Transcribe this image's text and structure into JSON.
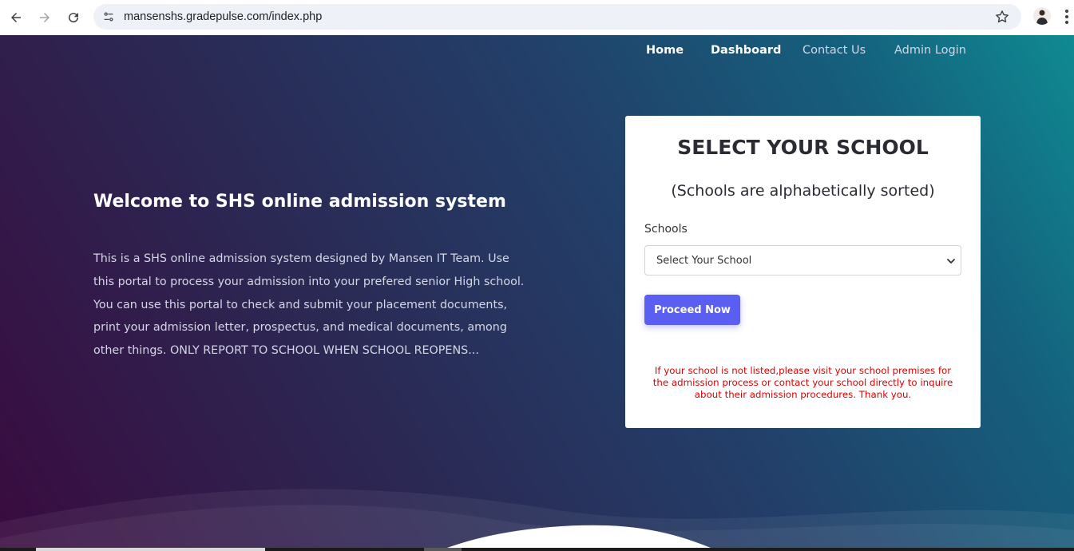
{
  "browser": {
    "url": "mansenshs.gradepulse.com/index.php",
    "icons": {
      "back": "arrow-left-icon",
      "forward": "arrow-right-icon",
      "reload": "reload-icon",
      "site_info": "tune-icon",
      "bookmark": "star-icon",
      "menu": "kebab-icon"
    }
  },
  "nav": {
    "home": "Home",
    "dashboard": "Dashboard",
    "contact": "Contact Us",
    "admin": "Admin Login"
  },
  "hero": {
    "title": "Welcome to SHS online admission system",
    "intro_lines": [
      "This is a SHS online admission system designed by Mansen IT Team. Use",
      "this portal to process your admission into your prefered senior High school.",
      "You can use this portal to check and submit your placement documents,",
      "print your admission letter, prospectus, and medical documents, among",
      "other things. ONLY REPORT TO SCHOOL WHEN SCHOOL REOPENS..."
    ]
  },
  "card": {
    "title": "SELECT YOUR SCHOOL",
    "subtitle": "(Schools are alphabetically sorted)",
    "field_label": "Schools",
    "select_value": "Select Your School",
    "button": "Proceed Now",
    "notice_lines": [
      "If your school is not listed,please visit your school premises for",
      "the admission process or contact your school directly to inquire",
      "about their admission procedures. Thank you."
    ]
  },
  "colors": {
    "accent_button": "#5a5ff2",
    "notice_red": "#e00000",
    "gradient_left": "#3a0b3f",
    "gradient_right": "#0f8a92"
  }
}
